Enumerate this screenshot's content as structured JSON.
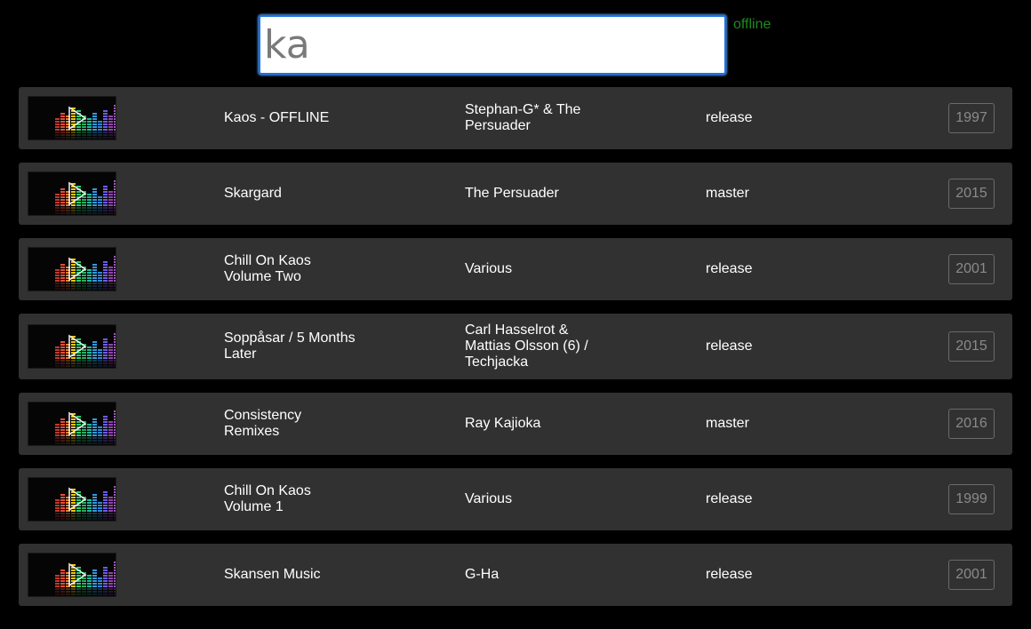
{
  "search": {
    "value": "ka",
    "placeholder": ""
  },
  "status": {
    "label": "offline",
    "color": "#1e8a1e"
  },
  "results": [
    {
      "title": "Kaos - OFFLINE",
      "artist": "Stephan-G* & The\nPersuader",
      "type": "release",
      "year": "1997",
      "thumb_icon": "equalizer-play-icon"
    },
    {
      "title": "Skargard",
      "artist": "The Persuader",
      "type": "master",
      "year": "2015",
      "thumb_icon": "equalizer-play-icon"
    },
    {
      "title": "Chill On Kaos\nVolume Two",
      "artist": "Various",
      "type": "release",
      "year": "2001",
      "thumb_icon": "equalizer-play-icon"
    },
    {
      "title": "Soppåsar / 5 Months\nLater",
      "artist": "Carl Hasselrot &\nMattias Olsson (6) /\nTechjacka",
      "type": "release",
      "year": "2015",
      "thumb_icon": "equalizer-play-icon"
    },
    {
      "title": "Consistency\nRemixes",
      "artist": "Ray Kajioka",
      "type": "master",
      "year": "2016",
      "thumb_icon": "equalizer-play-icon"
    },
    {
      "title": "Chill On Kaos\nVolume 1",
      "artist": "Various",
      "type": "release",
      "year": "1999",
      "thumb_icon": "equalizer-play-icon"
    },
    {
      "title": "Skansen Music",
      "artist": "G-Ha",
      "type": "release",
      "year": "2001",
      "thumb_icon": "equalizer-play-icon"
    }
  ]
}
